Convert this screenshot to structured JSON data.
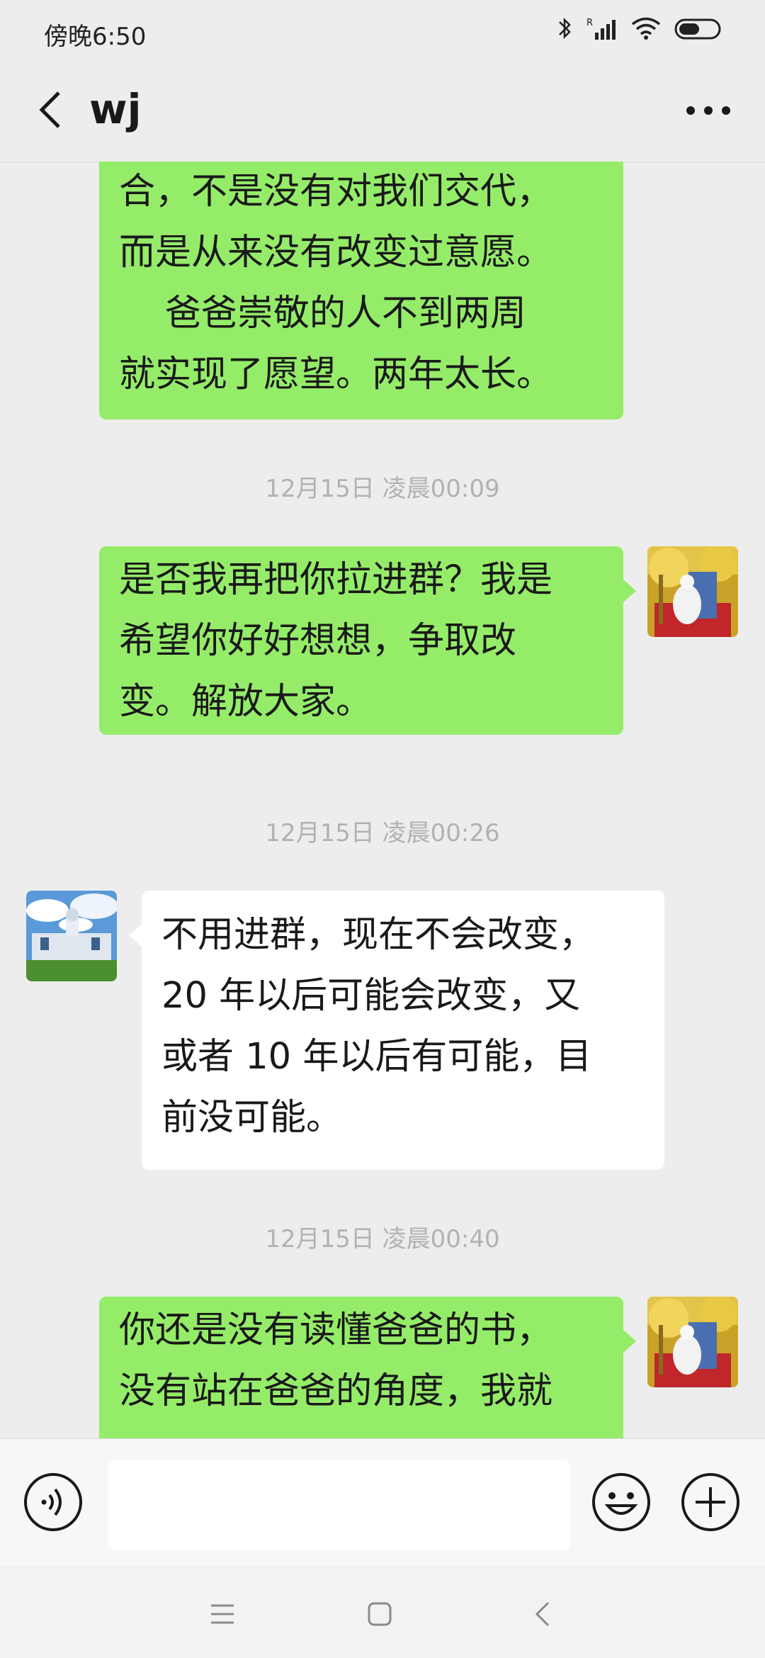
{
  "status": {
    "time": "傍晚6:50"
  },
  "header": {
    "title": "wj"
  },
  "messages": [
    {
      "from": "me",
      "text": "合，不是没有对我们交代，\n而是从来没有改变过意愿。\n    爸爸崇敬的人不到两周\n就实现了愿望。两年太长。"
    },
    {
      "timestamp": "12月15日 凌晨00:09"
    },
    {
      "from": "me",
      "text": "是否我再把你拉进群？我是\n希望你好好想想，争取改\n变。解放大家。"
    },
    {
      "timestamp": "12月15日 凌晨00:26"
    },
    {
      "from": "them",
      "text": "不用进群，现在不会改变，\n20 年以后可能会改变，又\n或者 10 年以后有可能，目\n前没可能。"
    },
    {
      "timestamp": "12月15日 凌晨00:40"
    },
    {
      "from": "me",
      "text": "你还是没有读懂爸爸的书，\n没有站在爸爸的角度，我就"
    }
  ],
  "colors": {
    "my_bubble": "#95ec69",
    "their_bubble": "#ffffff",
    "background": "#ededed"
  },
  "icons": {
    "back": "back-arrow-icon",
    "more": "more-icon",
    "voice": "voice-icon",
    "emoji": "emoji-icon",
    "plus": "plus-icon"
  }
}
